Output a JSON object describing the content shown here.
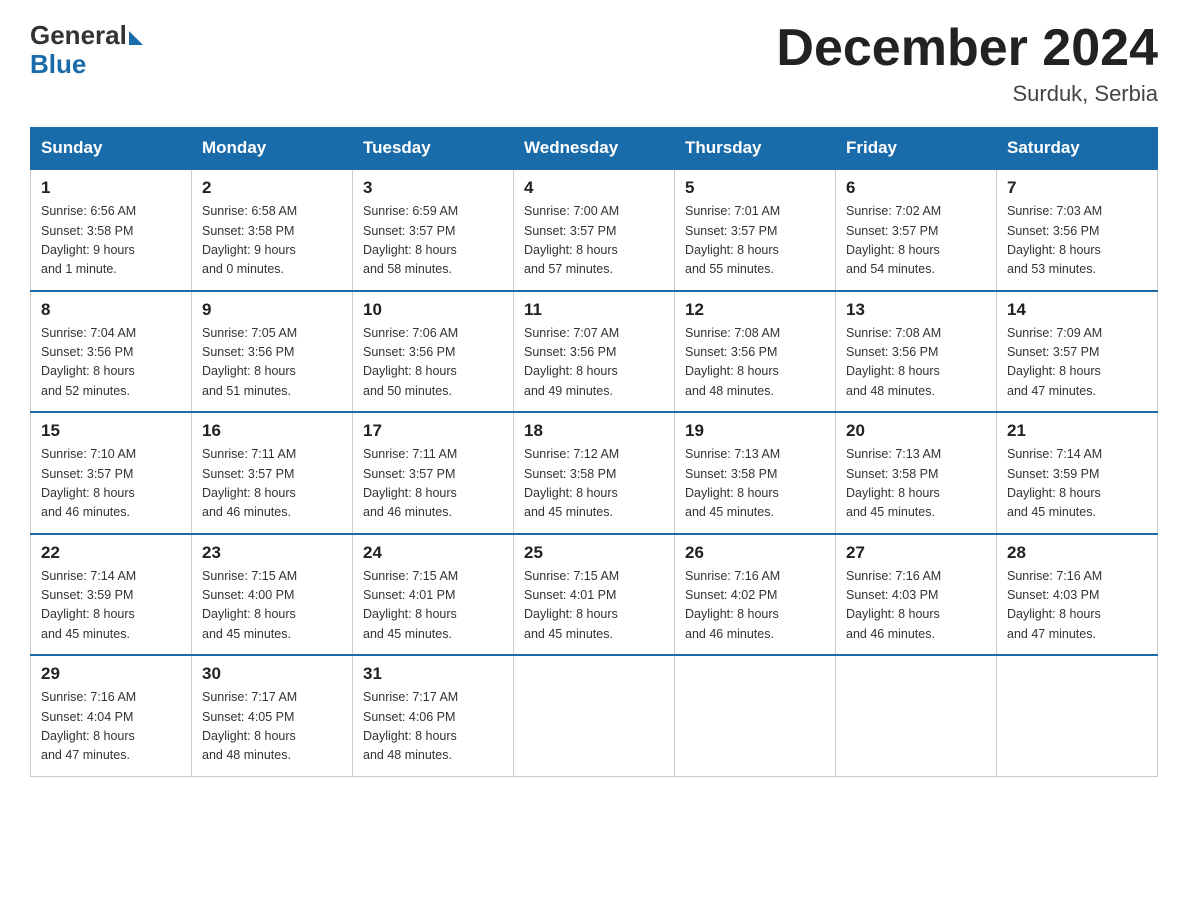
{
  "header": {
    "logo_general": "General",
    "logo_blue": "Blue",
    "month_title": "December 2024",
    "location": "Surduk, Serbia"
  },
  "days_of_week": [
    "Sunday",
    "Monday",
    "Tuesday",
    "Wednesday",
    "Thursday",
    "Friday",
    "Saturday"
  ],
  "weeks": [
    [
      {
        "day": "1",
        "info": "Sunrise: 6:56 AM\nSunset: 3:58 PM\nDaylight: 9 hours\nand 1 minute."
      },
      {
        "day": "2",
        "info": "Sunrise: 6:58 AM\nSunset: 3:58 PM\nDaylight: 9 hours\nand 0 minutes."
      },
      {
        "day": "3",
        "info": "Sunrise: 6:59 AM\nSunset: 3:57 PM\nDaylight: 8 hours\nand 58 minutes."
      },
      {
        "day": "4",
        "info": "Sunrise: 7:00 AM\nSunset: 3:57 PM\nDaylight: 8 hours\nand 57 minutes."
      },
      {
        "day": "5",
        "info": "Sunrise: 7:01 AM\nSunset: 3:57 PM\nDaylight: 8 hours\nand 55 minutes."
      },
      {
        "day": "6",
        "info": "Sunrise: 7:02 AM\nSunset: 3:57 PM\nDaylight: 8 hours\nand 54 minutes."
      },
      {
        "day": "7",
        "info": "Sunrise: 7:03 AM\nSunset: 3:56 PM\nDaylight: 8 hours\nand 53 minutes."
      }
    ],
    [
      {
        "day": "8",
        "info": "Sunrise: 7:04 AM\nSunset: 3:56 PM\nDaylight: 8 hours\nand 52 minutes."
      },
      {
        "day": "9",
        "info": "Sunrise: 7:05 AM\nSunset: 3:56 PM\nDaylight: 8 hours\nand 51 minutes."
      },
      {
        "day": "10",
        "info": "Sunrise: 7:06 AM\nSunset: 3:56 PM\nDaylight: 8 hours\nand 50 minutes."
      },
      {
        "day": "11",
        "info": "Sunrise: 7:07 AM\nSunset: 3:56 PM\nDaylight: 8 hours\nand 49 minutes."
      },
      {
        "day": "12",
        "info": "Sunrise: 7:08 AM\nSunset: 3:56 PM\nDaylight: 8 hours\nand 48 minutes."
      },
      {
        "day": "13",
        "info": "Sunrise: 7:08 AM\nSunset: 3:56 PM\nDaylight: 8 hours\nand 48 minutes."
      },
      {
        "day": "14",
        "info": "Sunrise: 7:09 AM\nSunset: 3:57 PM\nDaylight: 8 hours\nand 47 minutes."
      }
    ],
    [
      {
        "day": "15",
        "info": "Sunrise: 7:10 AM\nSunset: 3:57 PM\nDaylight: 8 hours\nand 46 minutes."
      },
      {
        "day": "16",
        "info": "Sunrise: 7:11 AM\nSunset: 3:57 PM\nDaylight: 8 hours\nand 46 minutes."
      },
      {
        "day": "17",
        "info": "Sunrise: 7:11 AM\nSunset: 3:57 PM\nDaylight: 8 hours\nand 46 minutes."
      },
      {
        "day": "18",
        "info": "Sunrise: 7:12 AM\nSunset: 3:58 PM\nDaylight: 8 hours\nand 45 minutes."
      },
      {
        "day": "19",
        "info": "Sunrise: 7:13 AM\nSunset: 3:58 PM\nDaylight: 8 hours\nand 45 minutes."
      },
      {
        "day": "20",
        "info": "Sunrise: 7:13 AM\nSunset: 3:58 PM\nDaylight: 8 hours\nand 45 minutes."
      },
      {
        "day": "21",
        "info": "Sunrise: 7:14 AM\nSunset: 3:59 PM\nDaylight: 8 hours\nand 45 minutes."
      }
    ],
    [
      {
        "day": "22",
        "info": "Sunrise: 7:14 AM\nSunset: 3:59 PM\nDaylight: 8 hours\nand 45 minutes."
      },
      {
        "day": "23",
        "info": "Sunrise: 7:15 AM\nSunset: 4:00 PM\nDaylight: 8 hours\nand 45 minutes."
      },
      {
        "day": "24",
        "info": "Sunrise: 7:15 AM\nSunset: 4:01 PM\nDaylight: 8 hours\nand 45 minutes."
      },
      {
        "day": "25",
        "info": "Sunrise: 7:15 AM\nSunset: 4:01 PM\nDaylight: 8 hours\nand 45 minutes."
      },
      {
        "day": "26",
        "info": "Sunrise: 7:16 AM\nSunset: 4:02 PM\nDaylight: 8 hours\nand 46 minutes."
      },
      {
        "day": "27",
        "info": "Sunrise: 7:16 AM\nSunset: 4:03 PM\nDaylight: 8 hours\nand 46 minutes."
      },
      {
        "day": "28",
        "info": "Sunrise: 7:16 AM\nSunset: 4:03 PM\nDaylight: 8 hours\nand 47 minutes."
      }
    ],
    [
      {
        "day": "29",
        "info": "Sunrise: 7:16 AM\nSunset: 4:04 PM\nDaylight: 8 hours\nand 47 minutes."
      },
      {
        "day": "30",
        "info": "Sunrise: 7:17 AM\nSunset: 4:05 PM\nDaylight: 8 hours\nand 48 minutes."
      },
      {
        "day": "31",
        "info": "Sunrise: 7:17 AM\nSunset: 4:06 PM\nDaylight: 8 hours\nand 48 minutes."
      },
      null,
      null,
      null,
      null
    ]
  ]
}
